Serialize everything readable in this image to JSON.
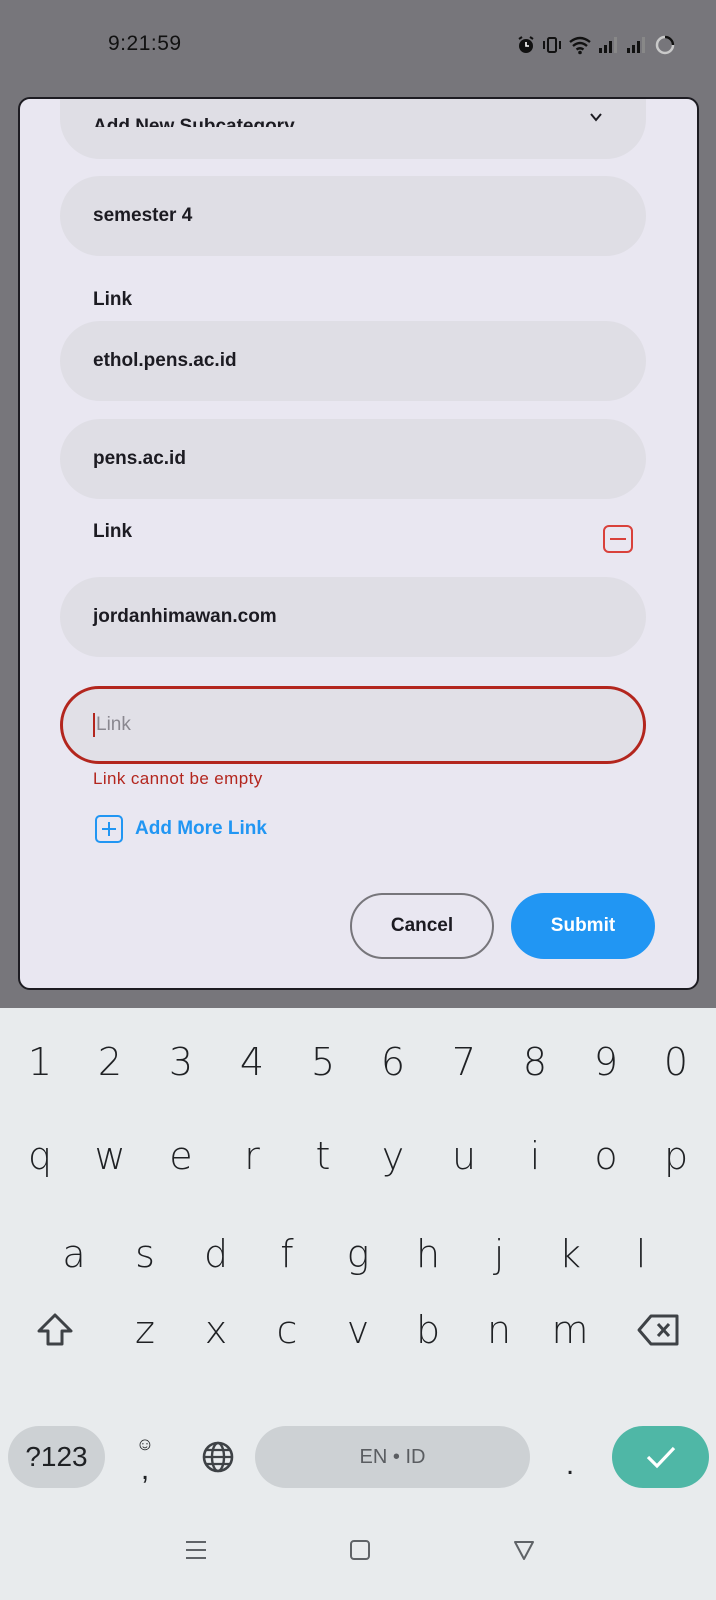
{
  "status_bar": {
    "time": "9:21:59",
    "icons": [
      "alarm-icon",
      "vibrate-icon",
      "wifi-icon",
      "signal-icon",
      "signal-icon",
      "loading-icon"
    ]
  },
  "dialog": {
    "partial_field_text": "Add New Subcategory",
    "subcategory_value": "semester 4",
    "link_section_1": {
      "label": "Link",
      "values": [
        "ethol.pens.ac.id",
        "pens.ac.id"
      ]
    },
    "link_section_2": {
      "label": "Link",
      "value": "jordanhimawan.com",
      "empty_placeholder": "Link",
      "error": "Link cannot be empty"
    },
    "add_more_label": "Add More Link",
    "cancel_label": "Cancel",
    "submit_label": "Submit"
  },
  "keyboard": {
    "number_row": [
      "1",
      "2",
      "3",
      "4",
      "5",
      "6",
      "7",
      "8",
      "9",
      "0"
    ],
    "row1": [
      "q",
      "w",
      "e",
      "r",
      "t",
      "y",
      "u",
      "i",
      "o",
      "p"
    ],
    "row2": [
      "a",
      "s",
      "d",
      "f",
      "g",
      "h",
      "j",
      "k",
      "l"
    ],
    "row3": [
      "z",
      "x",
      "c",
      "v",
      "b",
      "n",
      "m"
    ],
    "symbols_label": "?123",
    "emoji_label": "☺",
    "comma_label": ",",
    "space_label": "EN • ID",
    "period_label": ".",
    "enter_color": "#4fb7a6"
  },
  "colors": {
    "accent": "#2196f3",
    "error": "#b3261e",
    "remove": "#d9413b",
    "dialog_bg": "#e9e7f1",
    "scrim": "#77767b"
  }
}
